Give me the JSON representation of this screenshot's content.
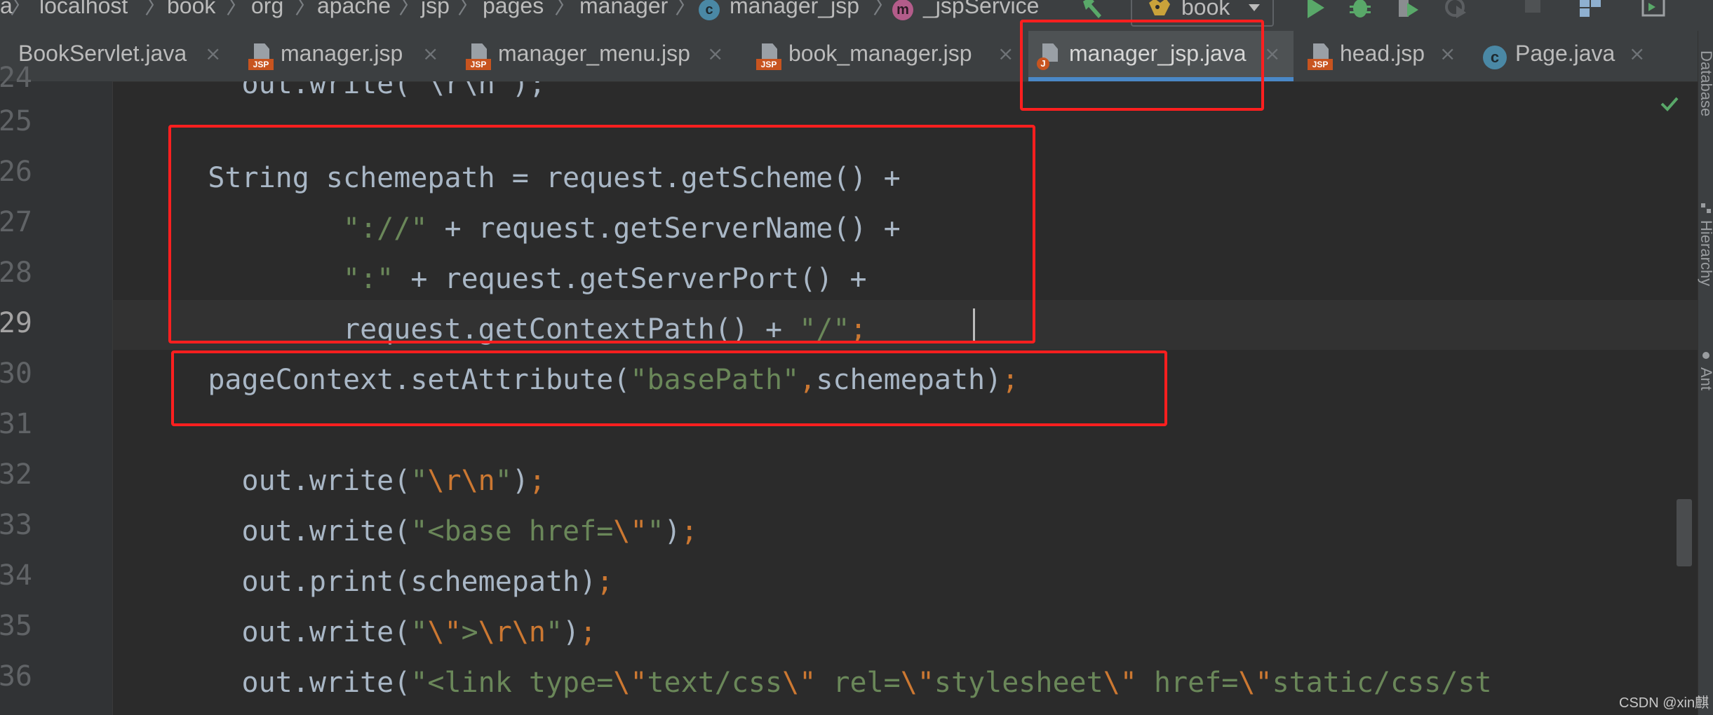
{
  "breadcrumb": {
    "items": [
      "a",
      "localhost",
      "book",
      "org",
      "apache",
      "jsp",
      "pages",
      "manager",
      "manager_jsp",
      "_jspService"
    ],
    "separator": "〉",
    "class_icon_letter": "c",
    "method_icon_letter": "m"
  },
  "toolbar": {
    "run_config_label": "book",
    "icons": [
      "build-hammer-icon",
      "run-icon",
      "debug-icon",
      "coverage-icon",
      "profile-icon",
      "stop-icon",
      "project-structure-icon",
      "window-icon"
    ]
  },
  "tabs": [
    {
      "label": "BookServlet.java",
      "icon": "none"
    },
    {
      "label": "manager.jsp",
      "icon": "jsp"
    },
    {
      "label": "manager_menu.jsp",
      "icon": "jsp"
    },
    {
      "label": "book_manager.jsp",
      "icon": "jsp"
    },
    {
      "label": "manager_jsp.java",
      "icon": "java",
      "active": true
    },
    {
      "label": "head.jsp",
      "icon": "jsp"
    },
    {
      "label": "Page.java",
      "icon": "class"
    }
  ],
  "tab_close": "×",
  "jsp_badge": "JSP",
  "java_badge": "J",
  "class_badge": "c",
  "side_panel": [
    "Database",
    "Hierarchy",
    "Ant"
  ],
  "editor": {
    "line_numbers": [
      "24",
      "25",
      "26",
      "27",
      "28",
      "29",
      "30",
      "31",
      "32",
      "33",
      "34",
      "35",
      "36"
    ],
    "current_line": "29",
    "lines": [
      [
        {
          "t": "      out.write(\"\\r\\n\");",
          "k": "text"
        }
      ],
      [],
      [
        {
          "t": "    String schemepath = request.getScheme() +",
          "k": "text"
        }
      ],
      [
        {
          "t": "            ",
          "k": "text"
        },
        {
          "t": "\"://\"",
          "k": "string"
        },
        {
          "t": " + request.getServerName() +",
          "k": "text"
        }
      ],
      [
        {
          "t": "            ",
          "k": "text"
        },
        {
          "t": "\":\"",
          "k": "string"
        },
        {
          "t": " + request.getServerPort() +",
          "k": "text"
        }
      ],
      [
        {
          "t": "            request.getContextPath() + ",
          "k": "text"
        },
        {
          "t": "\"/\"",
          "k": "string"
        },
        {
          "t": ";",
          "k": "punct"
        }
      ],
      [
        {
          "t": "    pageContext.setAttribute(",
          "k": "text"
        },
        {
          "t": "\"basePath\"",
          "k": "string"
        },
        {
          "t": ",",
          "k": "punct"
        },
        {
          "t": "schemepath)",
          "k": "text"
        },
        {
          "t": ";",
          "k": "punct"
        }
      ],
      [],
      [
        {
          "t": "      out.write(",
          "k": "text"
        },
        {
          "t": "\"",
          "k": "string"
        },
        {
          "t": "\\r\\n",
          "k": "escape"
        },
        {
          "t": "\"",
          "k": "string"
        },
        {
          "t": ")",
          "k": "text"
        },
        {
          "t": ";",
          "k": "punct"
        }
      ],
      [
        {
          "t": "      out.write(",
          "k": "text"
        },
        {
          "t": "\"<base href=",
          "k": "string"
        },
        {
          "t": "\\\"",
          "k": "escape"
        },
        {
          "t": "\"",
          "k": "string"
        },
        {
          "t": ")",
          "k": "text"
        },
        {
          "t": ";",
          "k": "punct"
        }
      ],
      [
        {
          "t": "      out.print(schemepath)",
          "k": "text"
        },
        {
          "t": ";",
          "k": "punct"
        }
      ],
      [
        {
          "t": "      out.write(",
          "k": "text"
        },
        {
          "t": "\"",
          "k": "string"
        },
        {
          "t": "\\\"",
          "k": "escape"
        },
        {
          "t": ">",
          "k": "string"
        },
        {
          "t": "\\r\\n",
          "k": "escape"
        },
        {
          "t": "\"",
          "k": "string"
        },
        {
          "t": ")",
          "k": "text"
        },
        {
          "t": ";",
          "k": "punct"
        }
      ],
      [
        {
          "t": "      out.write(",
          "k": "text"
        },
        {
          "t": "\"<link type=",
          "k": "string"
        },
        {
          "t": "\\\"",
          "k": "escape"
        },
        {
          "t": "text/css",
          "k": "string"
        },
        {
          "t": "\\\"",
          "k": "escape"
        },
        {
          "t": " rel=",
          "k": "string"
        },
        {
          "t": "\\\"",
          "k": "escape"
        },
        {
          "t": "stylesheet",
          "k": "string"
        },
        {
          "t": "\\\"",
          "k": "escape"
        },
        {
          "t": " href=",
          "k": "string"
        },
        {
          "t": "\\\"",
          "k": "escape"
        },
        {
          "t": "static/css/st",
          "k": "string"
        }
      ]
    ]
  },
  "watermark": "CSDN @xin麒",
  "colors": {
    "highlight_box": "#ff1f1f",
    "active_tab_underline": "#4a88c7",
    "string": "#6a8759",
    "keyword_punct": "#cc7832",
    "identifier": "#a9b7c6"
  }
}
